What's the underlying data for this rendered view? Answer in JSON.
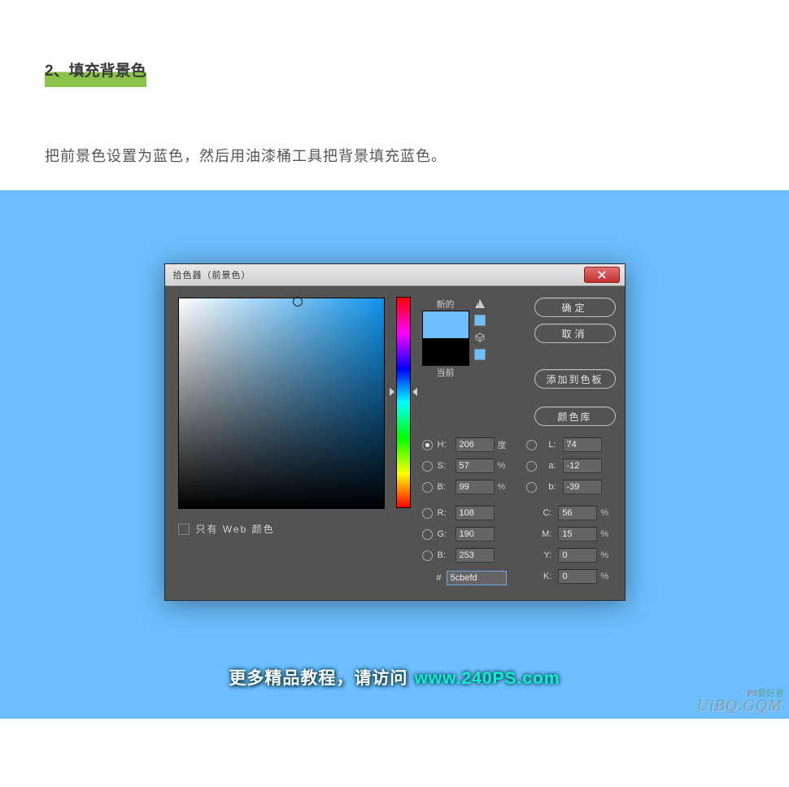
{
  "article": {
    "heading": "2、填充背景色",
    "paragraph": "把前景色设置为蓝色，然后用油漆桶工具把背景填充蓝色。"
  },
  "dialog": {
    "title": "拾色器（前景色）",
    "close_tooltip": "关闭",
    "swatch": {
      "new_label": "新的",
      "current_label": "当前",
      "new_color": "#6cbefd",
      "current_color": "#000000"
    },
    "buttons": {
      "ok": "确定",
      "cancel": "取消",
      "add_swatch": "添加到色板",
      "color_lib": "颜色库"
    },
    "hsb": {
      "h_label": "H:",
      "h_value": "206",
      "h_unit": "度",
      "s_label": "S:",
      "s_value": "57",
      "s_unit": "%",
      "b_label": "B:",
      "b_value": "99",
      "b_unit": "%"
    },
    "lab": {
      "l_label": "L:",
      "l_value": "74",
      "a_label": "a:",
      "a_value": "-12",
      "b_label": "b:",
      "b_value": "-39"
    },
    "rgb": {
      "r_label": "R:",
      "r_value": "108",
      "g_label": "G:",
      "g_value": "190",
      "b_label": "B:",
      "b_value": "253"
    },
    "cmyk": {
      "c_label": "C:",
      "c_value": "56",
      "m_label": "M:",
      "m_value": "15",
      "y_label": "Y:",
      "y_value": "0",
      "k_label": "K:",
      "k_value": "0",
      "unit": "%"
    },
    "hex": {
      "label": "#",
      "value": "5cbefd"
    },
    "web_only_label": "只有 Web 颜色"
  },
  "footer": {
    "text": "更多精品教程，请访问",
    "link": "www.240PS.com"
  },
  "watermark": {
    "main": "UiBQ.GQM",
    "small_prefix": "PS",
    "small_suffix": "爱好者"
  }
}
